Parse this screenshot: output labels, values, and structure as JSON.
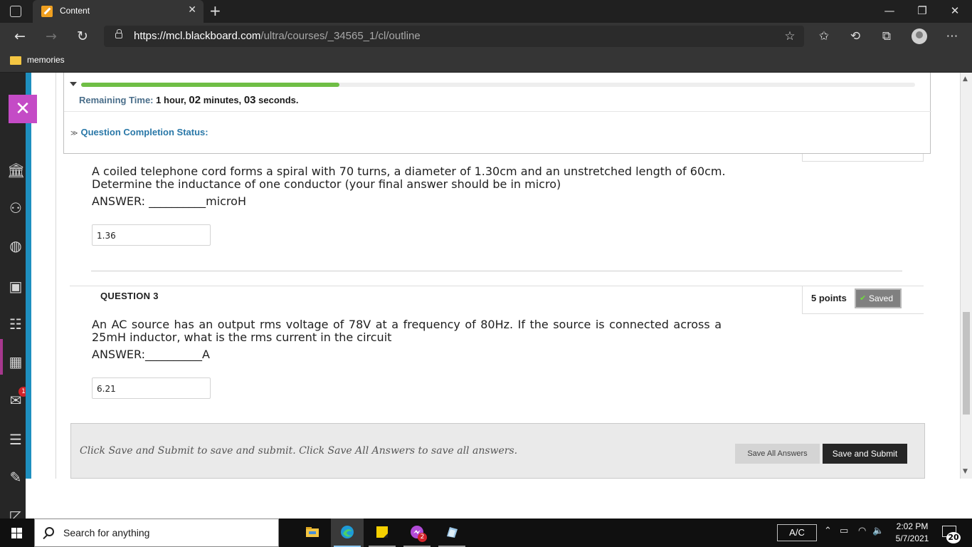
{
  "browser": {
    "tab_title": "Content",
    "url_host": "https://mcl.blackboard.com",
    "url_path": "/ultra/courses/_34565_1/cl/outline",
    "favorites": [
      {
        "label": "memories"
      }
    ]
  },
  "timer": {
    "remaining_label": "Remaining Time:",
    "hours_num": "1",
    "hours_unit": "hour,",
    "minutes_num": "02",
    "minutes_unit": "minutes,",
    "seconds_num": "03",
    "seconds_unit": "seconds.",
    "progress_fraction": 0.31,
    "completion_label": "Question Completion Status:"
  },
  "question2": {
    "text_line1": "A coiled telephone cord forms a spiral with 70 turns, a diameter of 1.30cm and an unstretched length of 60cm.",
    "text_line2": "Determine the inductance of one conductor (your final answer should be in micro)",
    "answer_line": "ANSWER: __________microH",
    "answer_value": "1.36"
  },
  "question3": {
    "title": "QUESTION 3",
    "points": "5 points",
    "status": "Saved",
    "text": "An AC source has an output rms voltage of 78V at a frequency of 80Hz.  If the source is connected across a 25mH inductor, what is the rms current in the circuit",
    "answer_line": "ANSWER:__________A",
    "answer_value": "6.21"
  },
  "footer": {
    "instructions": "Click Save and Submit to save and submit. Click Save All Answers to save all answers.",
    "save_all_label": "Save All Answers",
    "submit_label": "Save and Submit"
  },
  "taskbar": {
    "search_placeholder": "Search for anything",
    "ac_label": "A/C",
    "time": "2:02 PM",
    "date": "5/7/2021",
    "notification_count": "20",
    "messenger_badge": "2"
  },
  "rail": {
    "mail_badge": "1",
    "accent_color": "#1e8fbf",
    "close_color": "#c44bc6"
  },
  "icons": [
    "tab-actions-icon",
    "back-icon",
    "forward-icon",
    "refresh-icon",
    "lock-icon",
    "add-favorite-icon",
    "favorites-icon",
    "history-icon",
    "collections-icon",
    "profile-icon",
    "more-icon",
    "institution-icon",
    "profile-icon",
    "globe-icon",
    "courses-icon",
    "groups-icon",
    "calendar-icon",
    "messages-icon",
    "grades-icon",
    "tools-icon"
  ]
}
